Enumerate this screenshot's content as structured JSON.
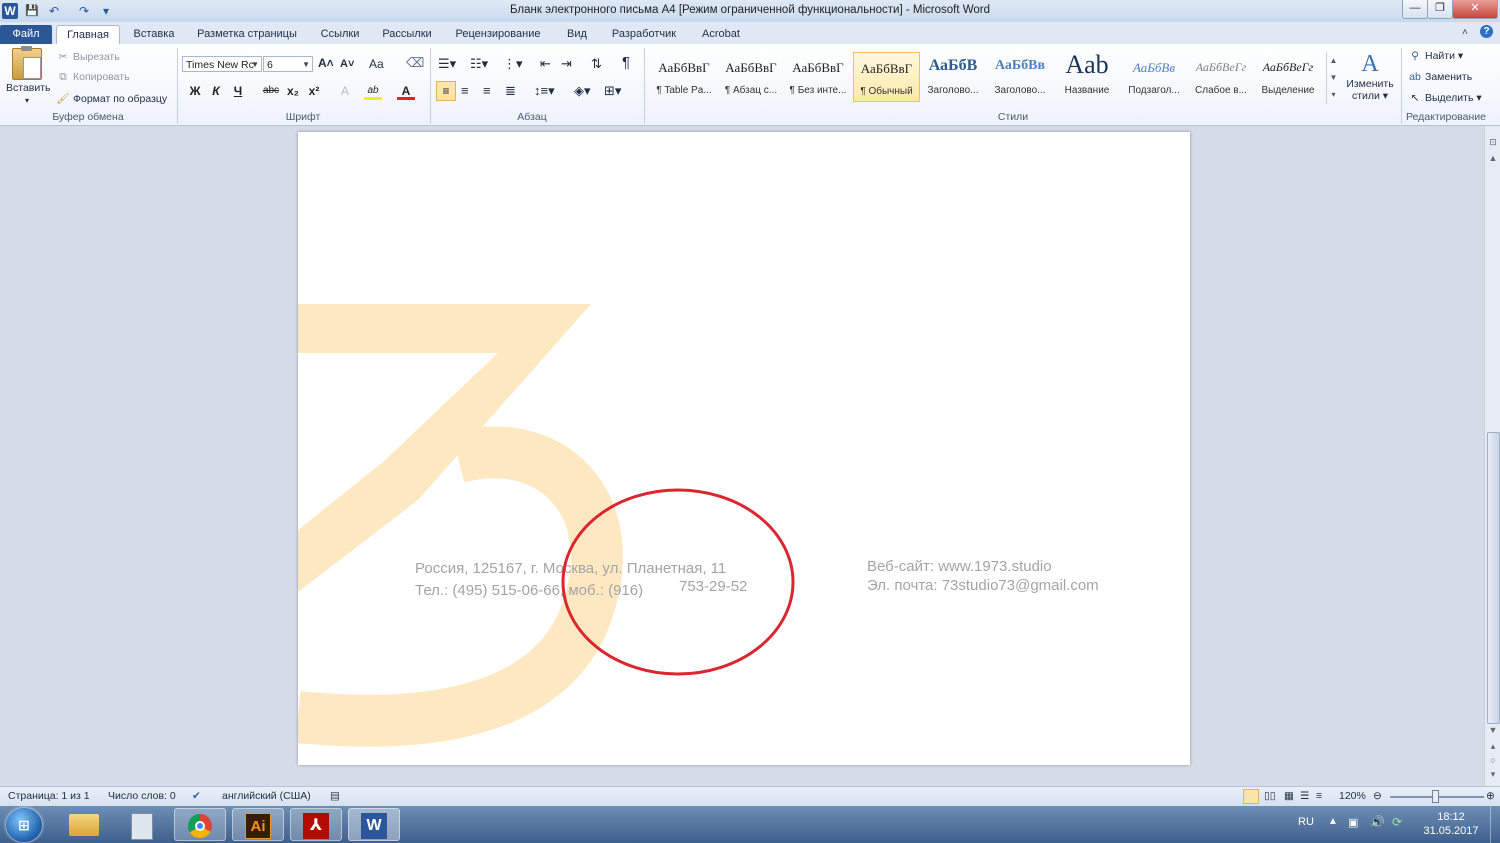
{
  "window": {
    "title": "Бланк электронного письма А4 [Режим ограниченной функциональности] - Microsoft Word",
    "min_label": "—",
    "max_label": "❐",
    "close_label": "✕"
  },
  "quick_access": {
    "word_icon": "W",
    "save_icon": "💾",
    "undo_icon": "↶",
    "redo_icon": "↷",
    "customize_icon": "▾"
  },
  "tabs": [
    "Файл",
    "Главная",
    "Вставка",
    "Разметка страницы",
    "Ссылки",
    "Рассылки",
    "Рецензирование",
    "Вид",
    "Разработчик",
    "Acrobat"
  ],
  "ribbon": {
    "clipboard": {
      "paste": "Вставить",
      "cut": "Вырезать",
      "copy": "Копировать",
      "format_painter": "Формат по образцу",
      "group_label": "Буфер обмена"
    },
    "font": {
      "font_name": "Times New Rc",
      "font_size": "6",
      "bold": "Ж",
      "italic": "К",
      "underline": "Ч",
      "strike": "abc",
      "subscript": "x₂",
      "superscript": "x²",
      "grow": "A˄",
      "shrink": "A˅",
      "change_case": "Aa",
      "clear_format": "A",
      "highlight": "ab",
      "font_color": "A",
      "group_label": "Шрифт"
    },
    "paragraph": {
      "pilcrow": "¶",
      "group_label": "Абзац"
    },
    "styles": {
      "items": [
        {
          "sample": "АаБбВвГ",
          "name": "¶ Table Pa..."
        },
        {
          "sample": "АаБбВвГ",
          "name": "¶ Абзац с..."
        },
        {
          "sample": "АаБбВвГ",
          "name": "¶ Без инте..."
        },
        {
          "sample": "АаБбВвГ",
          "name": "¶ Обычный"
        },
        {
          "sample": "АаБбВ",
          "name": "Заголово..."
        },
        {
          "sample": "АаБбВв",
          "name": "Заголово..."
        },
        {
          "sample": "Aab",
          "name": "Название"
        },
        {
          "sample": "АаБбВв",
          "name": "Подзагол..."
        },
        {
          "sample": "АаБбВеГг",
          "name": "Слабое в..."
        },
        {
          "sample": "АаБбВеГг",
          "name": "Выделение"
        }
      ],
      "change_styles": "Изменить стили",
      "group_label": "Стили"
    },
    "editing": {
      "find": "Найти",
      "replace": "Заменить",
      "select": "Выделить",
      "group_label": "Редактирование"
    }
  },
  "document": {
    "logo_text": "73",
    "address_line1": "Россия, 125167, г. Москва, ул. Планетная, 11",
    "address_line2a": "Тел.: (495) 515-06-66, моб.: (916)",
    "address_line2b": "753-29-52",
    "website_line": "Веб-сайт: www.1973.studio",
    "email_line": "Эл. почта: 73studio73@gmail.com",
    "logo_color": "#fde8c2",
    "annotation_color": "#d9262f"
  },
  "status": {
    "page": "Страница: 1 из 1",
    "words": "Число слов: 0",
    "language": "английский (США)",
    "zoom": "120%"
  },
  "taskbar": {
    "apps": [
      "windows-explorer",
      "calculator",
      "chrome",
      "illustrator",
      "acrobat",
      "word"
    ],
    "illustrator_label": "Ai",
    "word_label": "W",
    "lang": "RU",
    "time": "18:12",
    "date": "31.05.2017"
  }
}
